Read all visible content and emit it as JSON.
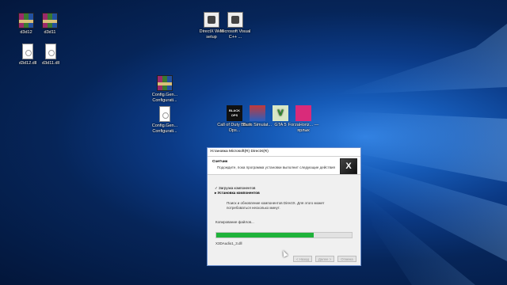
{
  "desktop": {
    "icons": [
      {
        "label": "d3d12",
        "type": "rar"
      },
      {
        "label": "d3d11",
        "type": "rar"
      },
      {
        "label": "d3d12.dll",
        "type": "doc"
      },
      {
        "label": "d3d11.dll",
        "type": "doc"
      },
      {
        "label": "DirectX Web setup",
        "type": "setup"
      },
      {
        "label": "Microsoft Visual C++ ...",
        "type": "setup"
      },
      {
        "label": "Config.Gen... Configurati...",
        "type": "rar"
      },
      {
        "label": "Config.Gen... Configurati...",
        "type": "doc"
      },
      {
        "label": "Call of Duty Black Ops...",
        "type": "game",
        "text": "BLACK OPS"
      },
      {
        "label": "Burn Simulat...",
        "type": "game"
      },
      {
        "label": "GTA 5",
        "type": "game",
        "text": "V"
      },
      {
        "label": "ForzaHoriz... — ярлык",
        "type": "game"
      }
    ]
  },
  "dialog": {
    "title": "Установка Microsoft(R) DirectX(R)",
    "header_title": "Счетчик",
    "header_subtitle": "Подождите, пока программа установки выполнит следующие действия",
    "logo_text": "X",
    "steps": [
      {
        "label": "✓ Загрузка компонентов",
        "status": "done"
      },
      {
        "label": "▸ Установка компонентов",
        "status": "current"
      }
    ],
    "message": "Поиск и обновление компонентов DirectX. Для этого может потребоваться несколько минут.",
    "copying_label": "Копирование файлов...",
    "progress_percent": 72,
    "current_file": "X3DAudio1_3.dll",
    "buttons": {
      "back": "< Назад",
      "next": "Далее >",
      "cancel": "Отмена"
    },
    "progress_color": "#1fb23a"
  }
}
